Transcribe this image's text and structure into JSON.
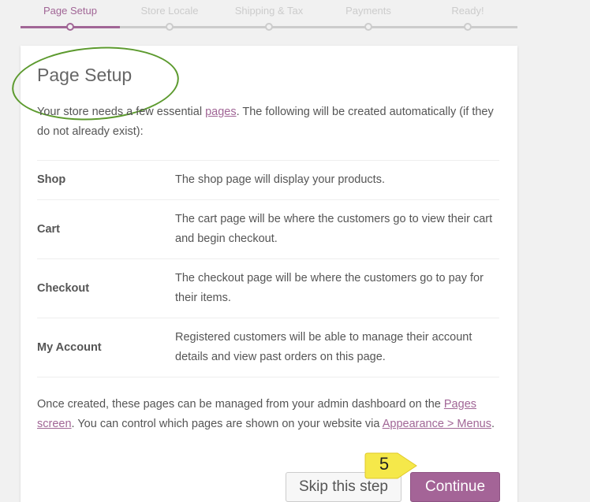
{
  "steps": [
    {
      "label": "Page Setup",
      "active": true
    },
    {
      "label": "Store Locale",
      "active": false
    },
    {
      "label": "Shipping & Tax",
      "active": false
    },
    {
      "label": "Payments",
      "active": false
    },
    {
      "label": "Ready!",
      "active": false
    }
  ],
  "card": {
    "title": "Page Setup",
    "intro_before": "Your store needs a few essential ",
    "intro_link": "pages",
    "intro_after": ". The following will be created automatically (if they do not already exist):",
    "pages": [
      {
        "name": "Shop",
        "description": "The shop page will display your products."
      },
      {
        "name": "Cart",
        "description": "The cart page will be where the customers go to view their cart and begin checkout."
      },
      {
        "name": "Checkout",
        "description": "The checkout page will be where the customers go to pay for their items."
      },
      {
        "name": "My Account",
        "description": "Registered customers will be able to manage their account details and view past orders on this page."
      }
    ],
    "outro_before": "Once created, these pages can be managed from your admin dashboard on the ",
    "outro_link1": "Pages screen",
    "outro_middle": ". You can control which pages are shown on your website via ",
    "outro_link2": "Appearance > Menus",
    "outro_after": ".",
    "skip_label": "Skip this step",
    "continue_label": "Continue"
  },
  "callout": {
    "number": "5"
  },
  "colors": {
    "accent": "#a16696",
    "annotation_green": "#5c9a2e",
    "callout_yellow": "#f5e84a"
  }
}
